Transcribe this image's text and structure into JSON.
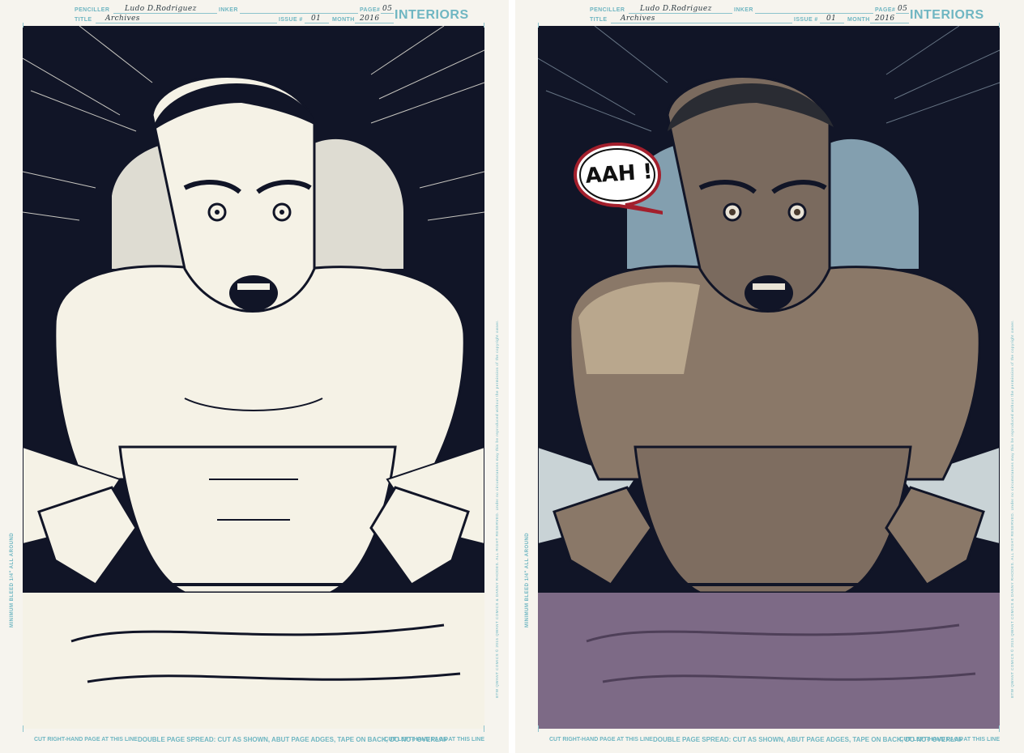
{
  "pages": [
    {
      "header": {
        "penciller_label": "PENCILLER",
        "penciller_value": "Ludo D.Rodriguez",
        "inker_label": "INKER",
        "page_label": "PAGE#",
        "page_value": "05",
        "title_label": "TITLE",
        "title_value": "Archives",
        "issue_label": "ISSUE #",
        "issue_value": "01",
        "month_label": "MONTH",
        "month_value": "2016",
        "brand": "INTERIORS"
      },
      "side_text": "MINIMUM BLEED 1/4\" ALL AROUND",
      "copyright": "BTW QWANT COMICS © 2015 QWANT COMICS & DANNY RHODES. ALL RIGHT RESERVED. Under no circumstances may this be reproduced without the permission of the copyright owner.",
      "footer": {
        "left": "CUT RIGHT-HAND PAGE AT THIS LINE",
        "middle": "DOUBLE PAGE SPREAD: CUT AS SHOWN, ABUT PAGE ADGES, TAPE ON BACK, DO NOT OVERLAP",
        "right": "CUT LEFT-HAND PAGE AT THIS LINE"
      }
    },
    {
      "header": {
        "penciller_label": "PENCILLER",
        "penciller_value": "Ludo D.Rodriguez",
        "inker_label": "INKER",
        "page_label": "PAGE#",
        "page_value": "05",
        "title_label": "TITLE",
        "title_value": "Archives",
        "issue_label": "ISSUE #",
        "issue_value": "01",
        "month_label": "MONTH",
        "month_value": "2016",
        "brand": "INTERIORS"
      },
      "side_text": "MINIMUM BLEED 1/4\" ALL AROUND",
      "copyright": "BTW QWANT COMICS © 2015 QWANT COMICS & DANNY RHODES. ALL RIGHT RESERVED. Under no circumstances may this be reproduced without the permission of the copyright owner.",
      "footer": {
        "left": "CUT RIGHT-HAND PAGE AT THIS LINE",
        "middle": "DOUBLE PAGE SPREAD: CUT AS SHOWN, ABUT PAGE ADGES, TAPE ON BACK, DO NOT OVERLAP",
        "right": "CUT LEFT-HAND PAGE AT THIS LINE"
      }
    }
  ],
  "speech_bubble": "AAH !",
  "colors": {
    "board": "#f6f4ee",
    "guide_cyan": "#6fb6c2",
    "night": "#111527",
    "ink_paper": "#f5f2e6",
    "skin": "#8a7868",
    "skin_highlight": "#d9c6a7",
    "sheet": "#c9d3d6",
    "blanket": "#7d6a86",
    "bubble_red": "#a31f2c"
  }
}
